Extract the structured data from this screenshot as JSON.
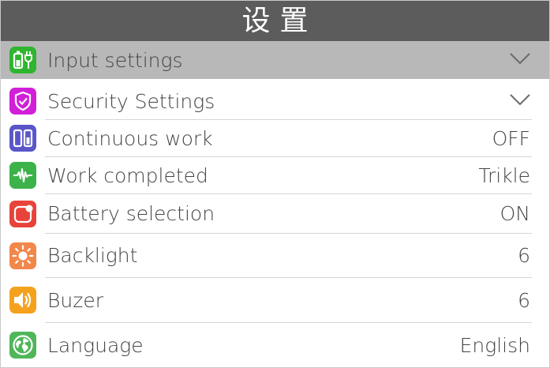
{
  "header": {
    "title": "设置"
  },
  "settings": [
    {
      "label": "Input settings",
      "value": "",
      "icon": "power-plug-icon",
      "icon_color": "#2fb52f",
      "selected": true,
      "expandable": true
    },
    {
      "label": "Security Settings",
      "value": "",
      "icon": "shield-icon",
      "icon_color": "#d21fd8",
      "selected": false,
      "expandable": true
    },
    {
      "label": "Continuous work",
      "value": "OFF",
      "icon": "battery-pair-icon",
      "icon_color": "#5a56c8",
      "selected": false,
      "expandable": false
    },
    {
      "label": "Work completed",
      "value": "Trikle",
      "icon": "waveform-icon",
      "icon_color": "#3cb24a",
      "selected": false,
      "expandable": false
    },
    {
      "label": "Battery selection",
      "value": "ON",
      "icon": "battery-select-icon",
      "icon_color": "#e8433a",
      "selected": false,
      "expandable": false
    },
    {
      "label": "Backlight",
      "value": "6",
      "icon": "sun-icon",
      "icon_color": "#f2874a",
      "selected": false,
      "expandable": false
    },
    {
      "label": "Buzer",
      "value": "6",
      "icon": "speaker-icon",
      "icon_color": "#f4a21e",
      "selected": false,
      "expandable": false
    },
    {
      "label": "Language",
      "value": "English",
      "icon": "globe-icon",
      "icon_color": "#4fb65a",
      "selected": false,
      "expandable": false
    }
  ],
  "colors": {
    "header_bg": "#5c5c5c",
    "selected_bg": "#b8b8b8",
    "text": "#454545",
    "divider": "#d6d6d6"
  }
}
